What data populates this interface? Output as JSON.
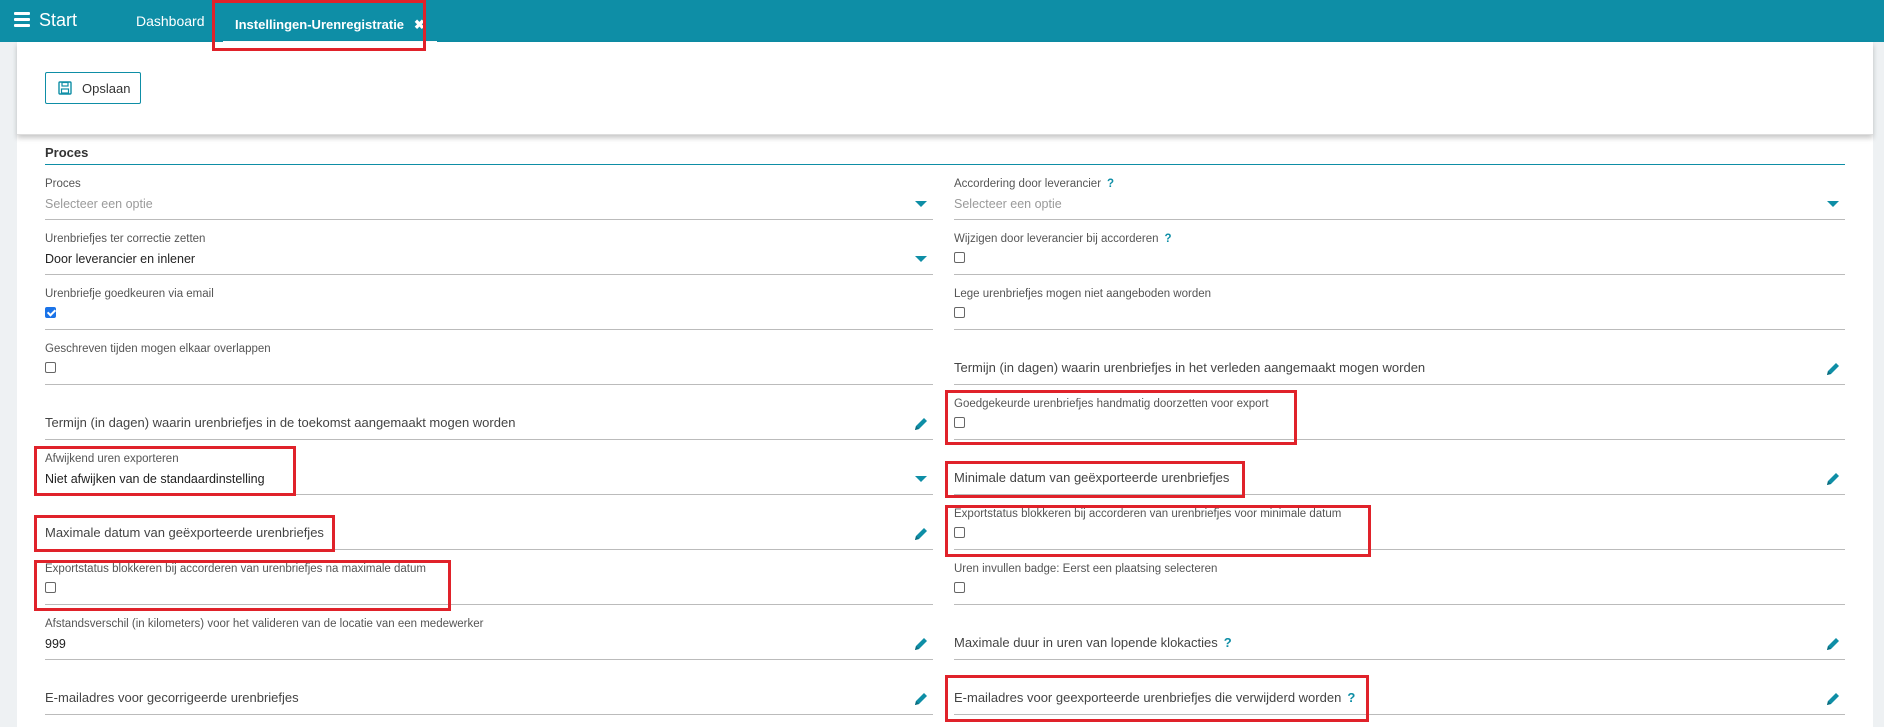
{
  "topbar": {
    "start_label": "Start",
    "tabs": [
      {
        "label": "Dashboard"
      },
      {
        "label": "Instellingen-Urenregistratie",
        "close_icon": "close-icon"
      }
    ]
  },
  "toolbar": {
    "save_label": "Opslaan",
    "save_icon": "floppy-disk-icon"
  },
  "section": {
    "title": "Proces"
  },
  "fields": {
    "proces": {
      "label": "Proces",
      "placeholder": "Selecteer een optie"
    },
    "accordering": {
      "label": "Accordering door leverancier",
      "help": "?",
      "placeholder": "Selecteer een optie"
    },
    "correctie": {
      "label": "Urenbriefjes ter correctie zetten",
      "value": "Door leverancier en inlener"
    },
    "wijzigen": {
      "label": "Wijzigen door leverancier bij accorderen",
      "help": "?",
      "checked": false
    },
    "goedkeuren_email": {
      "label": "Urenbriefje goedkeuren via email",
      "checked": true
    },
    "lege_urenbriefjes": {
      "label": "Lege urenbriefjes mogen niet aangeboden worden",
      "checked": false
    },
    "overlappen": {
      "label": "Geschreven tijden mogen elkaar overlappen",
      "checked": false
    },
    "termijn_verleden": {
      "label": "Termijn (in dagen) waarin urenbriefjes in het verleden aangemaakt mogen worden"
    },
    "termijn_toekomst": {
      "label": "Termijn (in dagen) waarin urenbriefjes in de toekomst aangemaakt mogen worden"
    },
    "handmatig_doorzetten": {
      "label": "Goedgekeurde urenbriefjes handmatig doorzetten voor export",
      "checked": false
    },
    "afwijkend_exporteren": {
      "label": "Afwijkend uren exporteren",
      "value": "Niet afwijken van de standaardinstelling"
    },
    "minimale_datum": {
      "label": "Minimale datum van geëxporteerde urenbriefjes"
    },
    "maximale_datum": {
      "label": "Maximale datum van geëxporteerde urenbriefjes"
    },
    "blokkeren_minimale": {
      "label": "Exportstatus blokkeren bij accorderen van urenbriefjes voor minimale datum",
      "checked": false
    },
    "blokkeren_maximale": {
      "label": "Exportstatus blokkeren bij accorderen van urenbriefjes na maximale datum",
      "checked": false
    },
    "badge": {
      "label": "Uren invullen badge: Eerst een plaatsing selecteren",
      "checked": false
    },
    "afstandsverschil": {
      "label": "Afstandsverschil (in kilometers) voor het valideren van de locatie van een medewerker",
      "value": "999"
    },
    "klokacties": {
      "label": "Maximale duur in uren van lopende klokacties",
      "help": "?"
    },
    "email_gecorrigeerd": {
      "label": "E-mailadres voor gecorrigeerde urenbriefjes"
    },
    "email_verwijderd": {
      "label": "E-mailadres voor geexporteerde urenbriefjes die verwijderd worden",
      "help": "?"
    }
  },
  "colors": {
    "accent": "#0e8ea6",
    "highlight": "#e0222a",
    "checkbox": "#1a73e8"
  }
}
